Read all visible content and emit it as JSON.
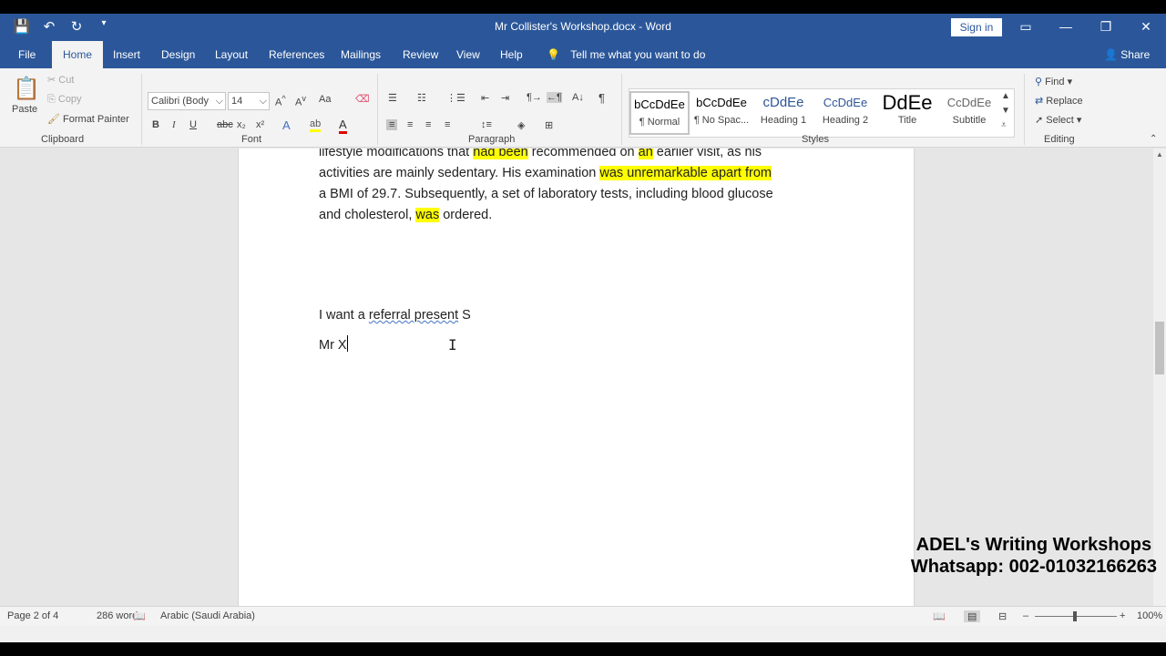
{
  "window": {
    "title": "Mr Collister's Workshop.docx - Word",
    "signin": "Sign in",
    "qat": [
      "💾",
      "↶",
      "↻",
      "▾"
    ]
  },
  "tabs": [
    {
      "label": "File"
    },
    {
      "label": "Home"
    },
    {
      "label": "Insert"
    },
    {
      "label": "Design"
    },
    {
      "label": "Layout"
    },
    {
      "label": "References"
    },
    {
      "label": "Mailings"
    },
    {
      "label": "Review"
    },
    {
      "label": "View"
    },
    {
      "label": "Help"
    }
  ],
  "tellme": "Tell me what you want to do",
  "share": "Share",
  "clipboard": {
    "paste": "Paste",
    "cut": "Cut",
    "copy": "Copy",
    "format_painter": "Format Painter",
    "label": "Clipboard"
  },
  "font": {
    "family": "Calibri (Body",
    "size": "14",
    "label": "Font",
    "bold": "B",
    "italic": "I",
    "underline": "U",
    "strike": "abc",
    "sub": "x₂",
    "sup": "x²",
    "case": "Aa"
  },
  "paragraph": {
    "label": "Paragraph",
    "pilcrow": "¶"
  },
  "styles": {
    "label": "Styles",
    "items": [
      {
        "preview": "bCcDdEe",
        "name": "¶ Normal"
      },
      {
        "preview": "bCcDdEe",
        "name": "¶ No Spac..."
      },
      {
        "preview": "cDdEe",
        "name": "Heading 1"
      },
      {
        "preview": "CcDdEe",
        "name": "Heading 2"
      },
      {
        "preview": "DdEe",
        "name": "Title"
      },
      {
        "preview": "CcDdEe",
        "name": "Subtitle"
      }
    ]
  },
  "editing": {
    "find": "Find",
    "replace": "Replace",
    "select": "Select",
    "label": "Editing"
  },
  "document": {
    "line1_a": "lifestyle modifications that ",
    "line1_hl1": "had been",
    "line1_b": " recommended on ",
    "line1_hl2": "an",
    "line1_c": " earlier visit, as his",
    "line2_a": "activities are mainly sedentary. His examination ",
    "line2_hl": "was unremarkable apart from",
    "line3": "a BMI of 29.7. Subsequently, a set of laboratory tests, including blood glucose",
    "line4_a": "and cholesterol, ",
    "line4_hl": "was",
    "line4_b": " ordered.",
    "line5_a": "I want a ",
    "line5_squig": "referral  present",
    "line5_b": " S",
    "line6": "Mr X"
  },
  "watermark": {
    "line1": "ADEL's Writing Workshops",
    "line2": "Whatsapp: 002-01032166263"
  },
  "status": {
    "page": "Page 2 of 4",
    "words": "286 words",
    "language": "Arabic (Saudi Arabia)",
    "zoom": "100%"
  }
}
